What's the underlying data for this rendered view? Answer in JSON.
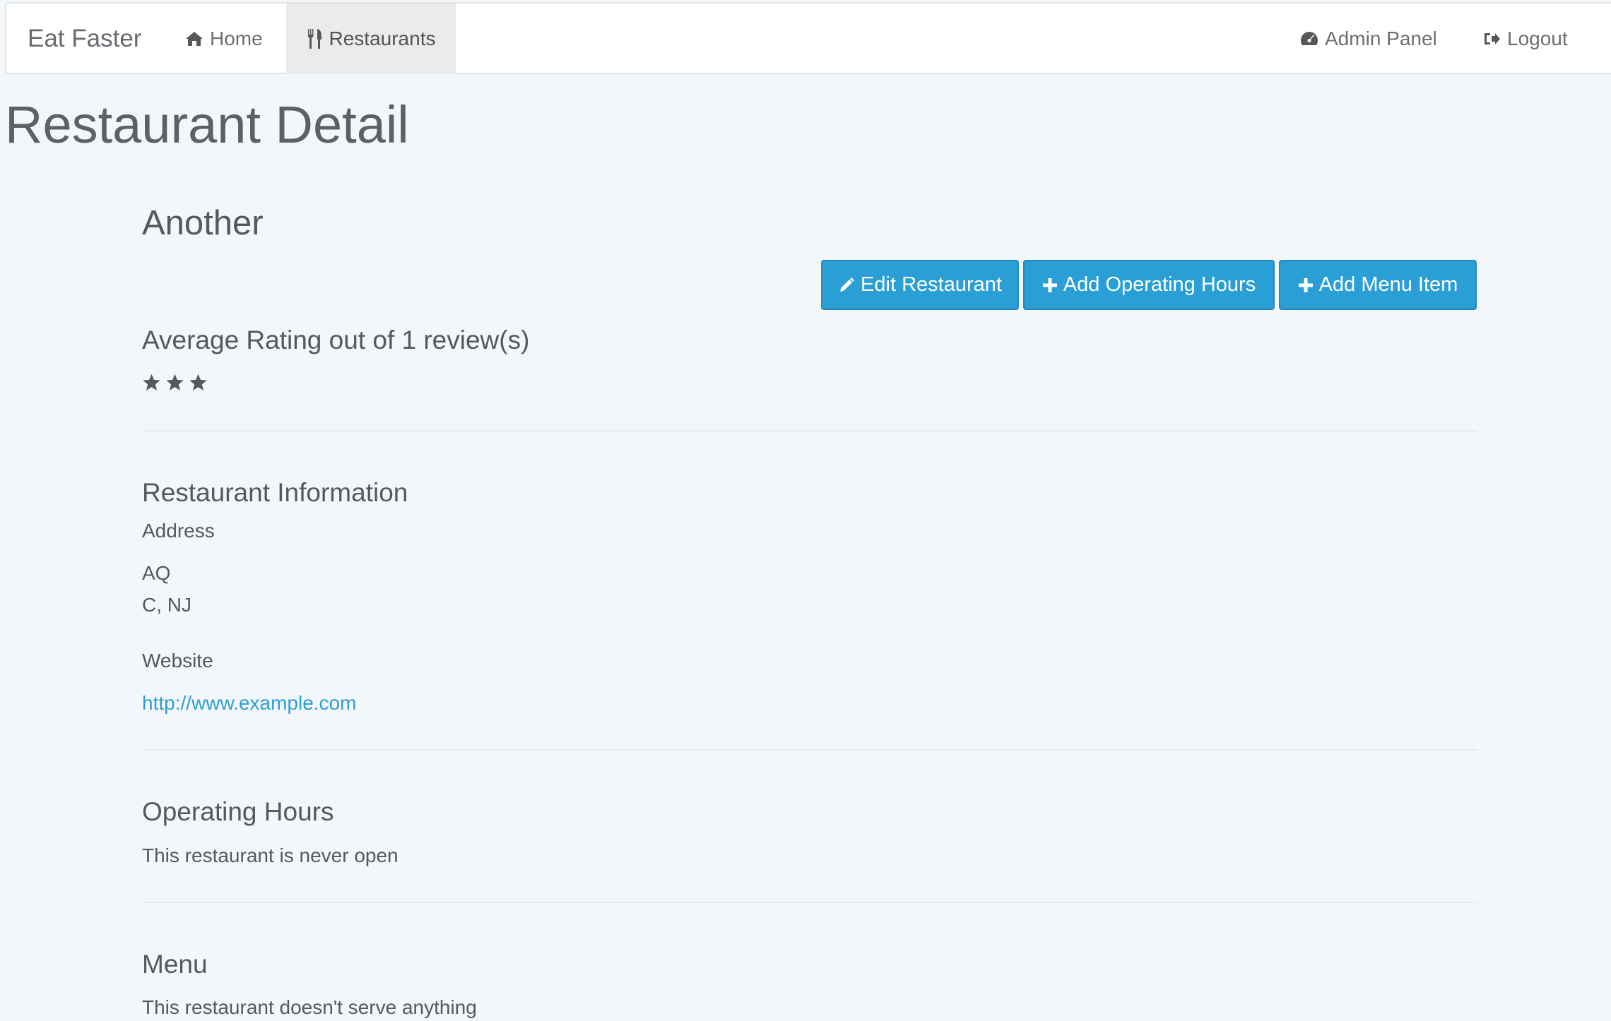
{
  "nav": {
    "brand": "Eat Faster",
    "home": "Home",
    "restaurants": "Restaurants",
    "admin": "Admin Panel",
    "logout": "Logout"
  },
  "page": {
    "title": "Restaurant Detail"
  },
  "restaurant": {
    "name": "Another",
    "rating_label": "Average Rating out of 1 review(s)",
    "rating_stars": 3
  },
  "buttons": {
    "edit": "Edit Restaurant",
    "add_hours": "Add Operating Hours",
    "add_menu": "Add Menu Item"
  },
  "info": {
    "title": "Restaurant Information",
    "address_label": "Address",
    "address_line1": "AQ",
    "address_line2": "C, NJ",
    "website_label": "Website",
    "website": "http://www.example.com"
  },
  "hours": {
    "title": "Operating Hours",
    "empty": "This restaurant is never open"
  },
  "menu": {
    "title": "Menu",
    "empty": "This restaurant doesn't serve anything"
  },
  "colors": {
    "accent": "#2a9fd6",
    "background": "#f4f7fa",
    "text": "#55595c"
  }
}
